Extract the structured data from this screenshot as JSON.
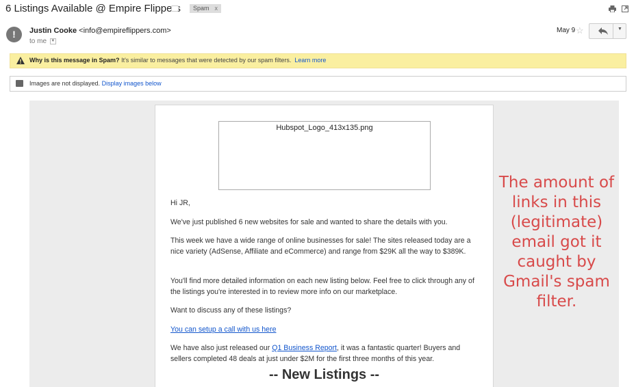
{
  "subject_bar": {
    "subject": "6 Listings Available @ Empire Flippers",
    "label": "Spam",
    "label_remove": "x",
    "print_icon": "print-icon",
    "new_window_icon": "new-window-icon"
  },
  "header": {
    "avatar_glyph": "!",
    "sender_name": "Justin Cooke",
    "sender_email": "<info@empireflippers.com>",
    "to": "to me",
    "date": "May 9",
    "star_icon": "star-icon",
    "reply_icon": "reply-icon",
    "more_icon": "chevron-down-icon"
  },
  "spam_warning": {
    "title": "Why is this message in Spam?",
    "text": "It's similar to messages that were detected by our spam filters.",
    "link": "Learn more",
    "bg_color": "#faefa0"
  },
  "images_bar": {
    "text": "Images are not displayed.",
    "link": "Display images below"
  },
  "email": {
    "logo_alt": "Hubspot_Logo_413x135.png",
    "greeting": "Hi JR,",
    "p1": "We've just published 6 new websites for sale and wanted to share the details with you.",
    "p2": "This week we have a wide range of online businesses for sale! The sites released today are a nice variety (AdSense, Affiliate and eCommerce) and range from $29K all the way to $389K.",
    "p3": "You'll find more detailed information on each new listing below. Feel free to click through any of the listings you're interested in to review more info on our marketplace.",
    "p4": "Want to discuss any of these listings?",
    "call_link": "You can setup a call with us here",
    "p5_before": "We have also just released our ",
    "report_link": "Q1 Business Report",
    "p5_after": ", it was a fantastic quarter! Buyers and sellers completed 48 deals at just under $2M for the first three months of this year.",
    "section_heading": "-- New Listings --"
  },
  "annotation": {
    "text": "The amount of links in this (legitimate) email got it caught by Gmail's spam filter.",
    "color": "#d84a4a"
  }
}
